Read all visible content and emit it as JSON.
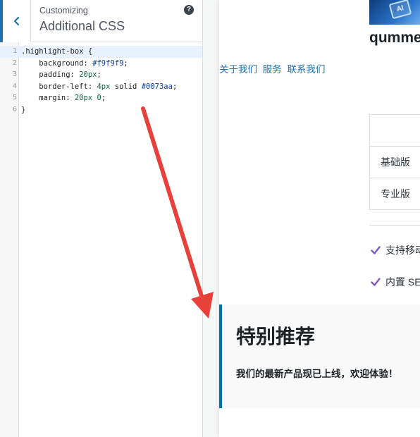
{
  "customizer": {
    "breadcrumb": "Customizing",
    "title": "Additional CSS",
    "help_glyph": "?",
    "code_lines": [
      {
        "num": "1",
        "text": ".highlight-box {"
      },
      {
        "num": "2",
        "text": "    background: #f9f9f9;"
      },
      {
        "num": "3",
        "text": "    padding: 20px;"
      },
      {
        "num": "4",
        "text": "    border-left: 4px solid #0073aa;"
      },
      {
        "num": "5",
        "text": "    margin: 20px 0;"
      },
      {
        "num": "6",
        "text": "}"
      }
    ]
  },
  "preview": {
    "logo_text": "AI",
    "site_title": "qumme",
    "nav": [
      "关于我们",
      "服务",
      "联系我们"
    ],
    "table_rows": [
      "",
      "基础版",
      "专业版"
    ],
    "features": [
      "支持移动",
      "内置 SE"
    ],
    "highlight": {
      "title": "特别推荐",
      "text": "我们的最新产品现已上线，欢迎体验！"
    }
  },
  "colors": {
    "accent": "#2271b1",
    "highlight_bg": "#f9f9f9",
    "highlight_border": "#0073aa",
    "arrow": "#e8413b",
    "check": "#7e5bbd"
  }
}
